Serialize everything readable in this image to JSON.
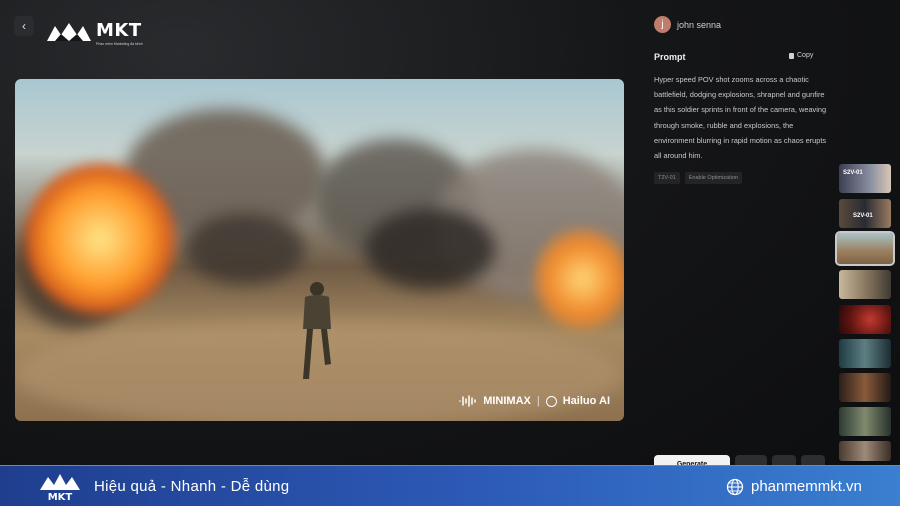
{
  "header": {
    "back_icon": "chevron-left-icon",
    "logo": {
      "name": "MKT",
      "tagline": "Phần mềm Marketing đa kênh"
    }
  },
  "video": {
    "watermark": {
      "brand_a": "MINIMAX",
      "separator": "|",
      "brand_b": "Hailuo AI"
    }
  },
  "user": {
    "avatar_letter": "j",
    "name": "john senna"
  },
  "prompt": {
    "title": "Prompt",
    "copy_label": "Copy",
    "text": "Hyper speed POV shot zooms across a chaotic battlefield, dodging explosions, shrapnel and gunfire as this soldier sprints in front of the camera, weaving through smoke, rubble and explosions, the environment blurring in rapid motion as chaos erupts all around him.",
    "tags": [
      "T2V-01",
      "Enable Optimization"
    ]
  },
  "thumbnails": [
    {
      "label": "S2V-01",
      "active": false
    },
    {
      "label": "S2V-01",
      "active": false
    },
    {
      "label": "",
      "active": true
    },
    {
      "label": "",
      "active": false
    },
    {
      "label": "",
      "active": false
    },
    {
      "label": "",
      "active": false
    },
    {
      "label": "",
      "active": false
    },
    {
      "label": "",
      "active": false
    },
    {
      "label": "",
      "active": false
    }
  ],
  "actions": {
    "generate_label": "Generate",
    "download_label": "",
    "more_label": ""
  },
  "banner": {
    "logo_text": "MKT",
    "slogan": "Hiệu quả - Nhanh - Dễ dùng",
    "website": "phanmemmkt.vn"
  },
  "colors": {
    "banner_start": "#1f3e8e",
    "banner_end": "#3a7fd0",
    "background": "#111214"
  }
}
